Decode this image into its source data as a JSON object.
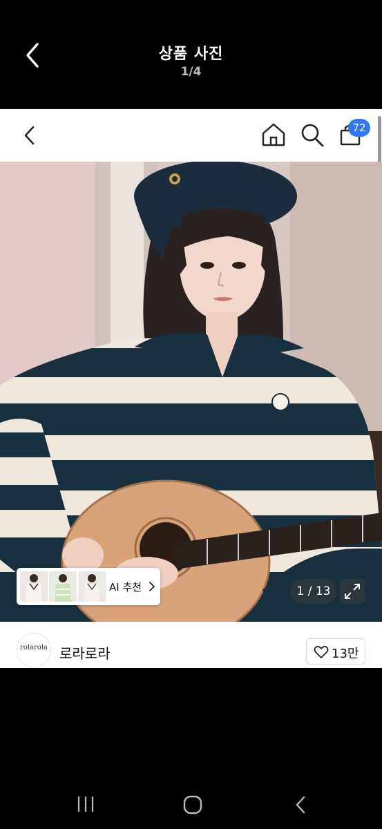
{
  "viewer": {
    "title": "상품 사진",
    "counter": "1/4"
  },
  "app_bar": {
    "icons": [
      "chevron-left-icon",
      "home-icon",
      "search-icon",
      "shopping-bag-icon"
    ],
    "cart_count": "72"
  },
  "product": {
    "ai_recommend_label": "AI 추천",
    "photo_counter": "1 / 13"
  },
  "store": {
    "logo_text": "rolarola",
    "name": "로라로라",
    "like_count": "13만"
  },
  "colors": {
    "accent_badge": "#3478f0",
    "sweater_navy": "#18303d",
    "sweater_cream": "#efe6dc",
    "guitar_wood": "#d9a37a"
  }
}
